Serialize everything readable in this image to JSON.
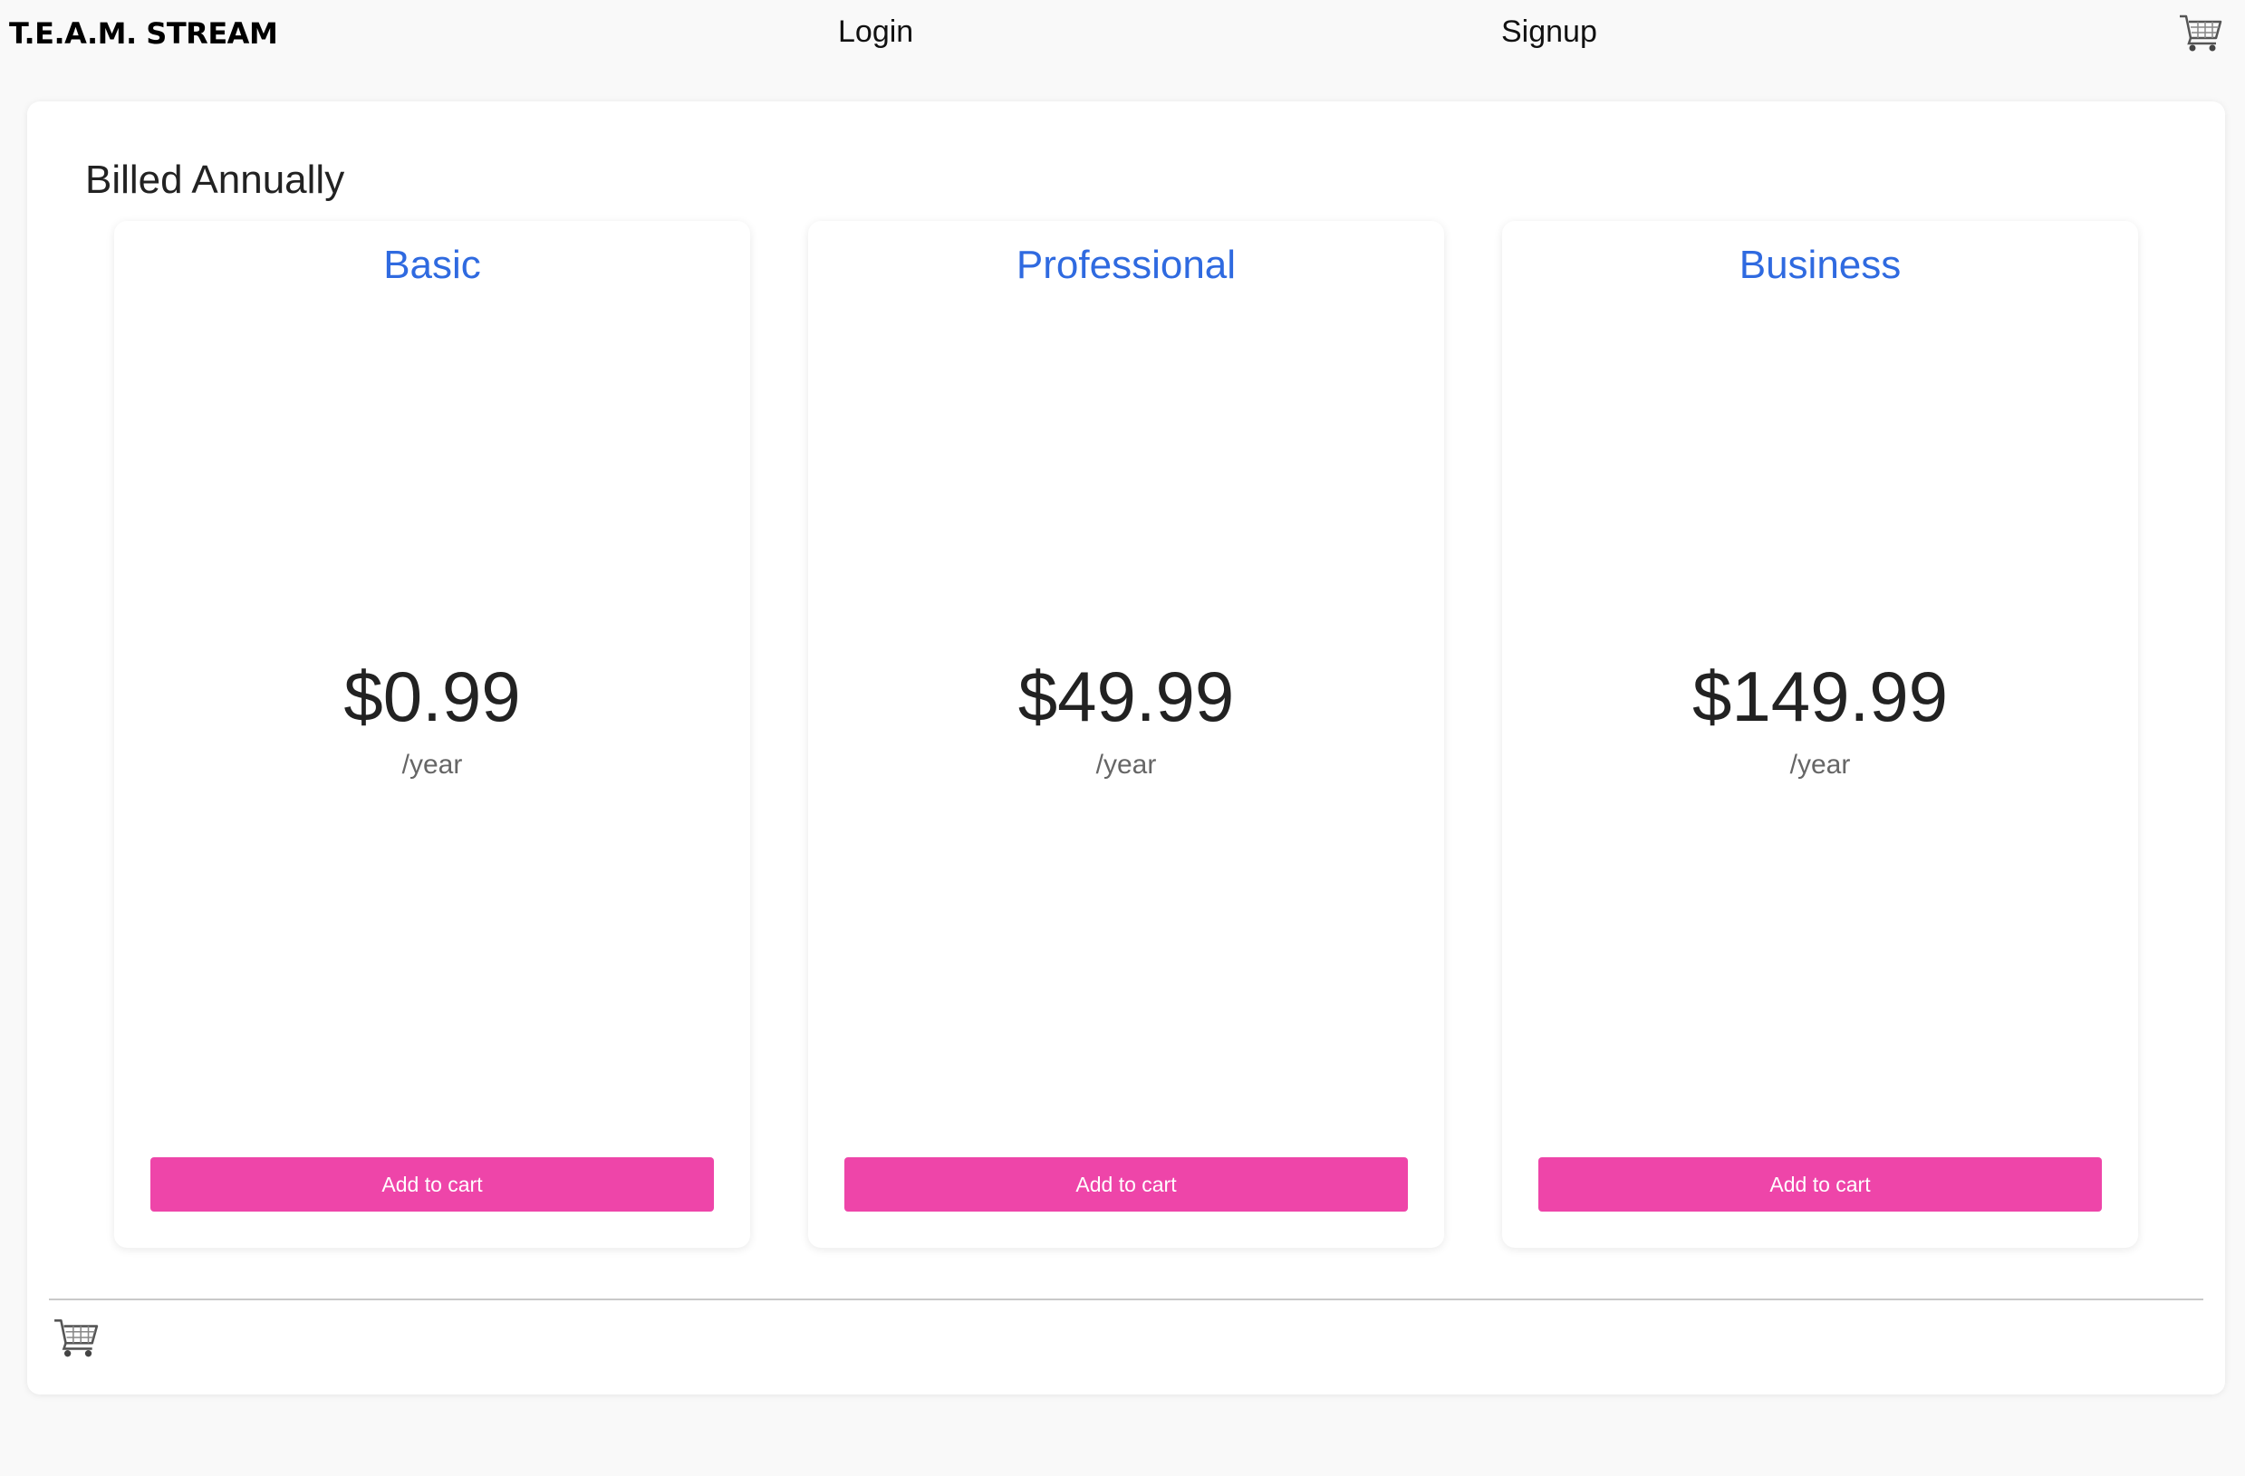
{
  "header": {
    "brand": "T.E.A.M. STREAM",
    "login_label": "Login",
    "signup_label": "Signup",
    "cart_icon": "shopping-cart-icon"
  },
  "main": {
    "section_title": "Billed Annually",
    "plans": [
      {
        "name": "Basic",
        "price": "$0.99",
        "period": "/year",
        "button_label": "Add to cart"
      },
      {
        "name": "Professional",
        "price": "$49.99",
        "period": "/year",
        "button_label": "Add to cart"
      },
      {
        "name": "Business",
        "price": "$149.99",
        "period": "/year",
        "button_label": "Add to cart"
      }
    ]
  },
  "footer": {
    "cart_icon": "shopping-cart-icon"
  },
  "colors": {
    "plan_title": "#2f6ae0",
    "button": "#ee45a9",
    "background": "#f9f9f9"
  }
}
